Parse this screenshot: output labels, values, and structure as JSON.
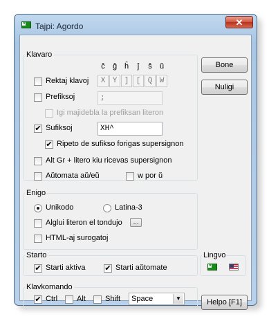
{
  "window": {
    "title": "Tajpi: Agordo",
    "close_glyph": "✕"
  },
  "klavaro": {
    "label": "Klavaro",
    "headers": [
      "ĉ",
      "ĝ",
      "ĥ",
      "ĵ",
      "ŝ",
      "ŭ"
    ],
    "rektaj": {
      "label": "Rektaj klavoj",
      "checked": false,
      "keys": [
        "X",
        "Y",
        "]",
        "[",
        "Q",
        "W"
      ]
    },
    "prefiksoj": {
      "label": "Prefiksoj",
      "checked": false,
      "value": ";"
    },
    "igi": {
      "label": "Igi majidebla la prefiksan literon",
      "checked": false,
      "enabled": false
    },
    "sufiksoj": {
      "label": "Sufiksoj",
      "checked": true,
      "value": "XH^"
    },
    "ripeto": {
      "label": "Ripeto de sufikso forigas supersignon",
      "checked": true
    },
    "altgr": {
      "label": "Alt Gr  + litero kiu ricevas supersignon",
      "checked": false
    },
    "automata": {
      "label": "Aŭtomata aŭ/eŭ",
      "checked": false
    },
    "wpor": {
      "label": "w por ŭ",
      "checked": false
    }
  },
  "enigo": {
    "label": "Enigo",
    "unikodo": {
      "label": "Unikodo",
      "selected": true
    },
    "latina": {
      "label": "Latina-3",
      "selected": false
    },
    "alglui": {
      "label": "Alglui literon el tondujo",
      "checked": false,
      "button": "..."
    },
    "html": {
      "label": "HTML-aj surogatoj",
      "checked": false
    }
  },
  "starto": {
    "label": "Starto",
    "aktiva": {
      "label": "Starti aktiva",
      "checked": true
    },
    "automate": {
      "label": "Starti aŭtomate",
      "checked": true
    }
  },
  "lingvo": {
    "label": "Lingvo",
    "flags": [
      "esperanto-flag",
      "us-flag"
    ]
  },
  "klavkomando": {
    "label": "Klavkomando",
    "ctrl": {
      "label": "Ctrl",
      "checked": true
    },
    "alt": {
      "label": "Alt",
      "checked": false
    },
    "shift": {
      "label": "Shift",
      "checked": false
    },
    "key": "Space"
  },
  "buttons": {
    "bone": "Bone",
    "nuligi": "Nuligi",
    "helpo": "Helpo [F1]"
  },
  "check_glyph": "✔",
  "combo_arrow": "▼"
}
